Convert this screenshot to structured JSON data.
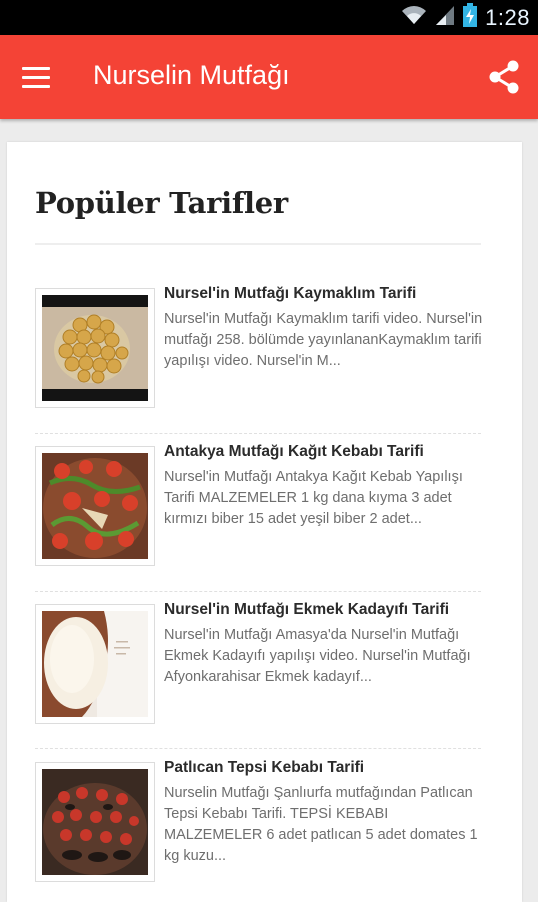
{
  "status_bar": {
    "time": "1:28",
    "icons": [
      "wifi-icon",
      "signal-icon",
      "battery-charging-icon"
    ]
  },
  "app_bar": {
    "title": "Nurselin Mutfağı",
    "menu_icon": "hamburger-menu-icon",
    "share_icon": "share-icon",
    "color": "#f44336"
  },
  "section": {
    "title": "Popüler Tarifler"
  },
  "recipes": [
    {
      "title": "Nursel'in Mutfağı Kaymaklım Tarifi",
      "description": "Nursel'in Mutfağı Kaymaklım tarifi video. Nursel'in mutfağı 258. bölümde yayınlananKaymaklım tarifi yapılışı video. Nursel'in M...",
      "thumbnail_icon": "dessert-plate-image"
    },
    {
      "title": "Antakya Mutfağı Kağıt Kebabı Tarifi",
      "description": "Nursel'in Mutfağı Antakya Kağıt Kebab Yapılışı Tarifi MALZEMELER 1 kg dana kıyma 3 adet kırmızı biber 15 adet yeşil biber 2 adet...",
      "thumbnail_icon": "kebab-tray-image"
    },
    {
      "title": "Nursel'in Mutfağı Ekmek Kadayıfı Tarifi",
      "description": "Nursel'in Mutfağı Amasya'da Nursel'in Mutfağı Ekmek Kadayıfı yapılışı video. Nursel'in Mutfağı Afyonkarahisar Ekmek kadayıf...",
      "thumbnail_icon": "bread-dessert-image"
    },
    {
      "title": "Patlıcan Tepsi Kebabı Tarifi",
      "description": "Nurselin Mutfağı Şanlıurfa mutfağından Patlıcan Tepsi Kebabı Tarifi. TEPSİ KEBABI MALZEMELER 6 adet patlıcan 5 adet domates 1 kg kuzu...",
      "thumbnail_icon": "eggplant-tray-image"
    }
  ]
}
